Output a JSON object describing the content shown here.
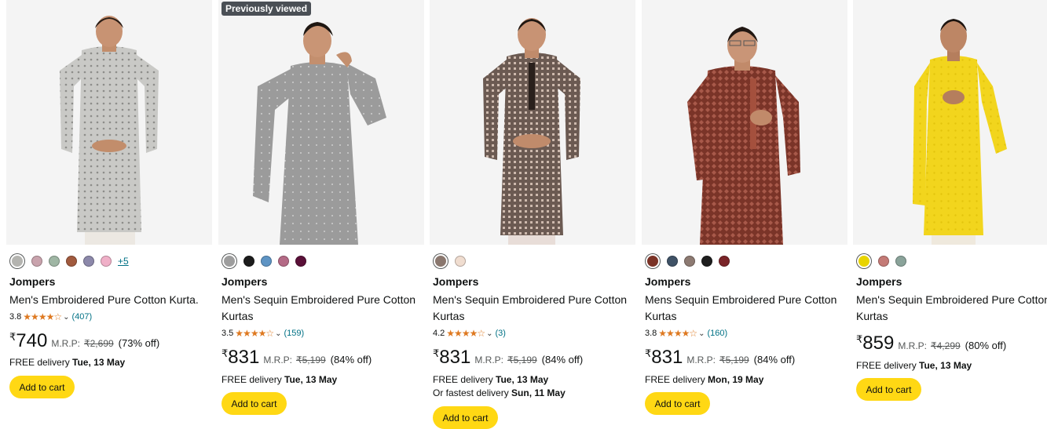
{
  "products": [
    {
      "brand": "Jompers",
      "title": "Men's Embroidered Pure Cotton Kurta.",
      "badge": "",
      "swatches": [
        "#b4b4b0",
        "#c9a3ad",
        "#9fb6a4",
        "#a15a3e",
        "#8c88aa",
        "#f0b0c8"
      ],
      "more_colors": "+5",
      "rating": "3.8",
      "stars": "★★★★☆",
      "rating_count": "(407)",
      "currency": "₹",
      "price": "740",
      "mrp_label": "M.R.P:",
      "mrp": "₹2,699",
      "discount": "(73% off)",
      "delivery_label": "FREE delivery",
      "delivery_date": "Tue, 13 May",
      "fastest_label": "",
      "fastest_date": "",
      "cart_label": "Add to cart",
      "image_icon": "grey-kurta-model-icon"
    },
    {
      "brand": "Jompers",
      "title": "Men's Sequin Embroidered Pure Cotton Kurtas",
      "badge": "Previously viewed",
      "swatches": [
        "#9d9d9d",
        "#1c1c1c",
        "#5e94c4",
        "#b46a86",
        "#5a1038"
      ],
      "more_colors": "",
      "rating": "3.5",
      "stars": "★★★★☆",
      "rating_count": "(159)",
      "currency": "₹",
      "price": "831",
      "mrp_label": "M.R.P:",
      "mrp": "₹5,199",
      "discount": "(84% off)",
      "delivery_label": "FREE delivery",
      "delivery_date": "Tue, 13 May",
      "fastest_label": "",
      "fastest_date": "",
      "cart_label": "Add to cart",
      "image_icon": "grey-sequin-kurta-model-icon"
    },
    {
      "brand": "Jompers",
      "title": "Men's Sequin Embroidered Pure Cotton Kurtas",
      "badge": "",
      "swatches": [
        "#8a776e",
        "#f0ddd0"
      ],
      "more_colors": "",
      "rating": "4.2",
      "stars": "★★★★☆",
      "rating_count": "(3)",
      "currency": "₹",
      "price": "831",
      "mrp_label": "M.R.P:",
      "mrp": "₹5,199",
      "discount": "(84% off)",
      "delivery_label": "FREE delivery",
      "delivery_date": "Tue, 13 May",
      "fastest_label": "Or fastest delivery",
      "fastest_date": "Sun, 11 May",
      "cart_label": "Add to cart",
      "image_icon": "brown-sequin-kurta-model-icon"
    },
    {
      "brand": "Jompers",
      "title": "Mens Sequin Embroidered Pure Cotton Kurtas",
      "badge": "",
      "swatches": [
        "#7a3226",
        "#3f5266",
        "#8d7a72",
        "#1e1e1e",
        "#7a2428"
      ],
      "more_colors": "",
      "rating": "3.8",
      "stars": "★★★★☆",
      "rating_count": "(160)",
      "currency": "₹",
      "price": "831",
      "mrp_label": "M.R.P:",
      "mrp": "₹5,199",
      "discount": "(84% off)",
      "delivery_label": "FREE delivery",
      "delivery_date": "Mon, 19 May",
      "fastest_label": "",
      "fastest_date": "",
      "cart_label": "Add to cart",
      "image_icon": "rust-sequin-kurta-model-icon"
    },
    {
      "brand": "Jompers",
      "title": "Men's Sequin Embroidered Pure Cotton Kurtas",
      "badge": "",
      "swatches": [
        "#e8d400",
        "#c47a76",
        "#8aa39a"
      ],
      "more_colors": "",
      "rating": "",
      "stars": "",
      "rating_count": "",
      "currency": "₹",
      "price": "859",
      "mrp_label": "M.R.P:",
      "mrp": "₹4,299",
      "discount": "(80% off)",
      "delivery_label": "FREE delivery",
      "delivery_date": "Tue, 13 May",
      "fastest_label": "",
      "fastest_date": "",
      "cart_label": "Add to cart",
      "image_icon": "yellow-kurta-model-icon"
    }
  ]
}
